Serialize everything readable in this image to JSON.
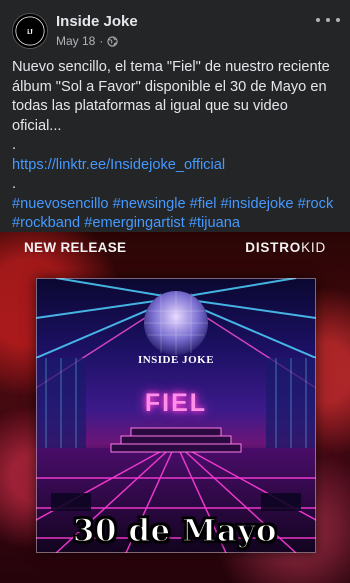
{
  "post": {
    "page_name": "Inside Joke",
    "date": "May 18",
    "separator": "·",
    "avatar_text": "INSIDE JOKE",
    "body_line": "Nuevo sencillo, el tema \"Fiel\" de nuestro reciente álbum \"Sol a Favor\" disponible el 30 de Mayo en todas las plataformas al igual que su video oficial...",
    "dot1": ".",
    "link": "https://linktr.ee/Insidejoke_official",
    "dot2": ".",
    "hashtags": "#nuevosencillo #newsingle #fiel #insidejoke #rock #rockband #emergingartist #tijuana"
  },
  "media": {
    "new_release": "NEW RELEASE",
    "distro_bold": "DISTRO",
    "distro_light": "KID",
    "art_brand": "INSIDE JOKE",
    "art_title": "FIEL",
    "date_overlay": "30 de Mayo"
  },
  "icons": {
    "privacy": "globe-icon",
    "menu": "more-options-icon"
  },
  "colors": {
    "background": "#242526",
    "text": "#e4e6eb",
    "secondary_text": "#b0b3b8",
    "link": "#4599ff"
  }
}
